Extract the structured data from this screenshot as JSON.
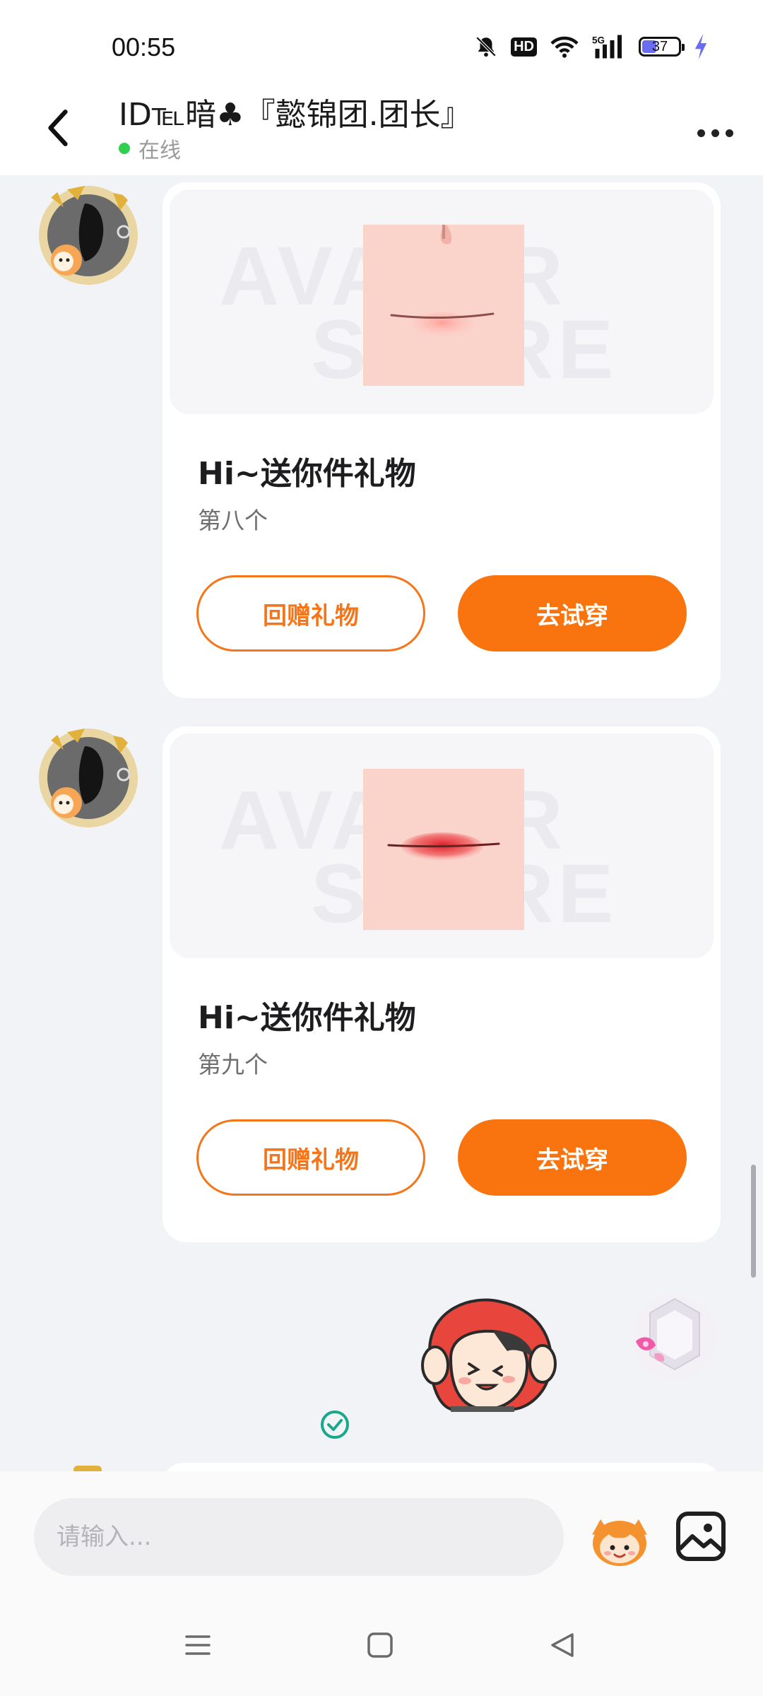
{
  "status_bar": {
    "time": "00:55",
    "battery": "37",
    "network": "5G"
  },
  "header": {
    "title": "ID℡暗♣『懿锦团.团长』",
    "status": "在线"
  },
  "messages": [
    {
      "title": "Hi~送你件礼物",
      "subtitle": "第八个",
      "return_label": "回赠礼物",
      "try_label": "去试穿",
      "watermark_top": "AVATAR",
      "watermark_bottom": "STORE"
    },
    {
      "title": "Hi~送你件礼物",
      "subtitle": "第九个",
      "return_label": "回赠礼物",
      "try_label": "去试穿",
      "watermark_top": "AVATAR",
      "watermark_bottom": "STORE"
    }
  ],
  "input": {
    "placeholder": "请输入..."
  },
  "icons": {
    "back": "chevron-left-icon",
    "more": "more-icon",
    "mute": "bell-off-icon",
    "wifi": "wifi-icon",
    "signal": "signal-icon",
    "charging": "lightning-icon",
    "emoji": "emoji-sticker-icon",
    "image": "image-icon",
    "read": "check-circle-icon",
    "menu": "menu-icon",
    "home": "square-icon",
    "nav_back": "triangle-back-icon"
  },
  "colors": {
    "accent": "#f9740f",
    "online": "#2fd04f",
    "read_check": "#18a88a",
    "battery_fill": "#6a6cf2",
    "charging": "#6a6cf2"
  }
}
